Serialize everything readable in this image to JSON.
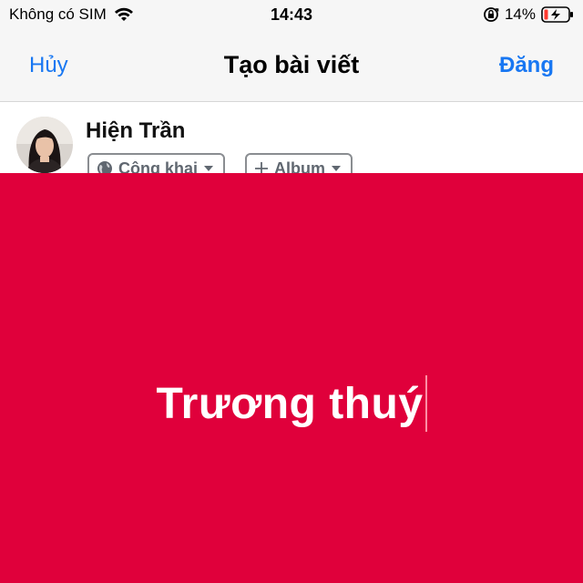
{
  "status_bar": {
    "carrier": "Không có SIM",
    "time": "14:43",
    "battery": "14%",
    "icons": [
      "wifi-icon",
      "rotation-lock-icon",
      "battery-charging-icon"
    ]
  },
  "nav": {
    "cancel_label": "Hủy",
    "title": "Tạo bài viết",
    "post_label": "Đăng"
  },
  "author": {
    "name": "Hiện Trần",
    "privacy_label": "Công khai",
    "album_label": "Album",
    "icons": [
      "globe-icon",
      "plus-icon",
      "caret-down-icon"
    ]
  },
  "post": {
    "text": "Trương thuý",
    "background_color": "#e0003b"
  },
  "colors": {
    "accent": "#1877f2"
  }
}
